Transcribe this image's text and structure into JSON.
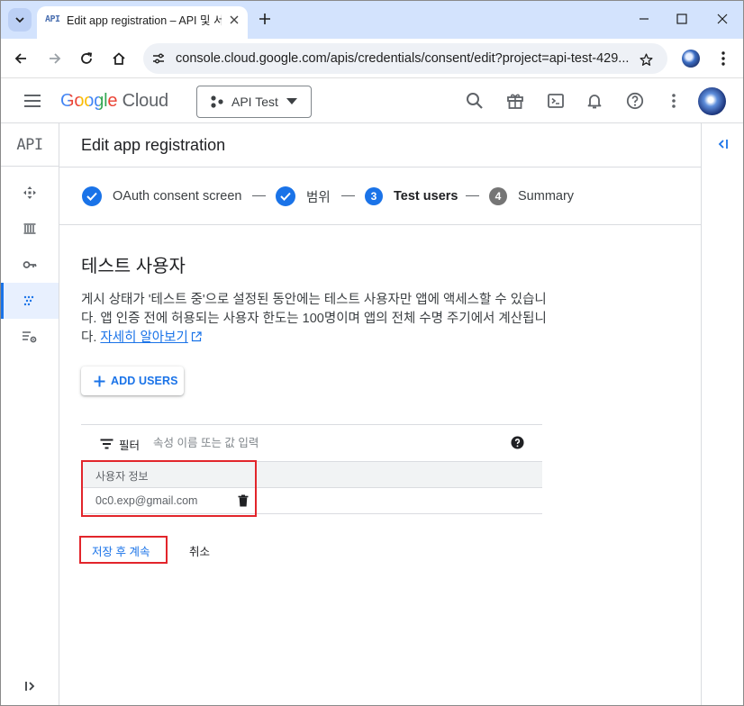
{
  "browser": {
    "tab": {
      "favicon": "API",
      "title": "Edit app registration – API 및 서비스"
    },
    "url": "console.cloud.google.com/apis/credentials/consent/edit?project=api-test-429..."
  },
  "header": {
    "logo_google": "Google",
    "logo_cloud": "Cloud",
    "project_label": "API Test"
  },
  "rail": {
    "api_label": "API"
  },
  "page": {
    "title": "Edit app registration"
  },
  "stepper": {
    "steps": [
      {
        "label": "OAuth consent screen",
        "state": "done"
      },
      {
        "label": "범위",
        "state": "done"
      },
      {
        "number": "3",
        "label": "Test users",
        "state": "current"
      },
      {
        "number": "4",
        "label": "Summary",
        "state": "todo"
      }
    ]
  },
  "section": {
    "title": "테스트 사용자",
    "description": "게시 상태가 '테스트 중'으로 설정된 동안에는 테스트 사용자만 앱에 액세스할 수 있습니다. 앱 인증 전에 허용되는 사용자 한도는 100명이며 앱의 전체 수명 주기에서 계산됩니다. ",
    "learn_more": "자세히 알아보기"
  },
  "add_users_label": "ADD USERS",
  "filter": {
    "label": "필터",
    "placeholder": "속성 이름 또는 값 입력"
  },
  "table": {
    "header": "사용자 정보",
    "rows": [
      {
        "email": "0c0.exp@gmail.com"
      }
    ]
  },
  "actions": {
    "save": "저장 후 계속",
    "cancel": "취소"
  },
  "colors": {
    "accent": "#1a73e8",
    "highlight": "#e2252b",
    "tabstrip": "#d3e3fd"
  }
}
